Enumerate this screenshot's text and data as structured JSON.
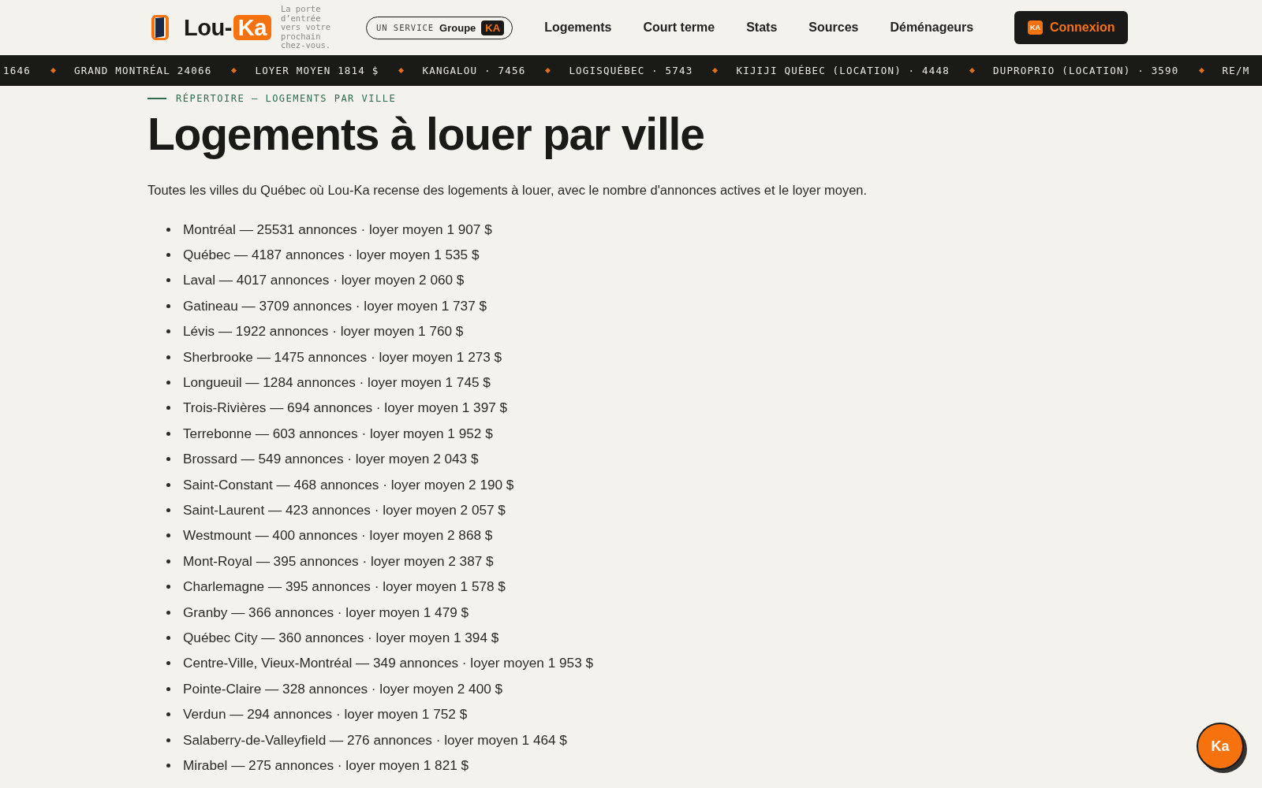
{
  "header": {
    "logo": {
      "text": "Lou-",
      "badge": "Ka"
    },
    "tagline": "La porte d’entrée vers votre prochain chez-vous.",
    "service": {
      "label": "UN SERVICE",
      "brand": "Groupe",
      "badge": "KA"
    },
    "nav": [
      "Logements",
      "Court terme",
      "Stats",
      "Sources",
      "Déménageurs"
    ],
    "login": {
      "badge": "KA",
      "label": "Connexion"
    }
  },
  "ticker": [
    "1646",
    "GRAND MONTRÉAL 24066",
    "LOYER MOYEN 1814 $",
    "KANGALOU · 7456",
    "LOGISQUÉBEC · 5743",
    "KIJIJI QUÉBEC (LOCATION) · 4448",
    "DUPROPRIO (LOCATION) · 3590",
    "RE/M"
  ],
  "eyebrow": "RÉPERTOIRE — LOGEMENTS PAR VILLE",
  "title": "Logements à louer par ville",
  "intro": "Toutes les villes du Québec où Lou-Ka recense des logements à louer, avec le nombre d'annonces actives et le loyer moyen.",
  "cities": [
    "Montréal — 25531 annonces · loyer moyen 1 907 $",
    "Québec — 4187 annonces · loyer moyen 1 535 $",
    "Laval — 4017 annonces · loyer moyen 2 060 $",
    "Gatineau — 3709 annonces · loyer moyen 1 737 $",
    "Lévis — 1922 annonces · loyer moyen 1 760 $",
    "Sherbrooke — 1475 annonces · loyer moyen 1 273 $",
    "Longueuil — 1284 annonces · loyer moyen 1 745 $",
    "Trois-Rivières — 694 annonces · loyer moyen 1 397 $",
    "Terrebonne — 603 annonces · loyer moyen 1 952 $",
    "Brossard — 549 annonces · loyer moyen 2 043 $",
    "Saint-Constant — 468 annonces · loyer moyen 2 190 $",
    "Saint-Laurent — 423 annonces · loyer moyen 2 057 $",
    "Westmount — 400 annonces · loyer moyen 2 868 $",
    "Mont-Royal — 395 annonces · loyer moyen 2 387 $",
    "Charlemagne — 395 annonces · loyer moyen 1 578 $",
    "Granby — 366 annonces · loyer moyen 1 479 $",
    "Québec City — 360 annonces · loyer moyen 1 394 $",
    "Centre-Ville, Vieux-Montréal — 349 annonces · loyer moyen 1 953 $",
    "Pointe-Claire — 328 annonces · loyer moyen 2 400 $",
    "Verdun — 294 annonces · loyer moyen 1 752 $",
    "Salaberry-de-Valleyfield — 276 annonces · loyer moyen 1 464 $",
    "Mirabel — 275 annonces · loyer moyen 1 821 $"
  ],
  "chat_button": "Ka"
}
